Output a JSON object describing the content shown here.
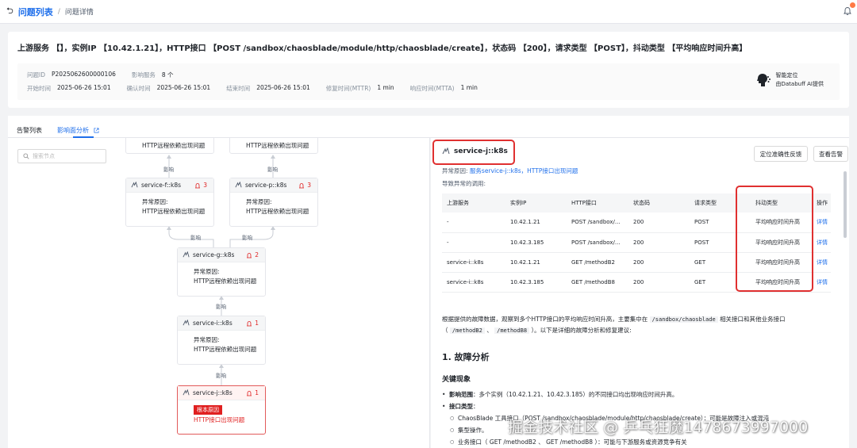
{
  "breadcrumb": {
    "back_glyph": "⮌",
    "list": "问题列表",
    "sep": "/",
    "current": "问题详情"
  },
  "summary": {
    "title": "上游服务 【】，实例IP 【10.42.1.21】，HTTP接口 【POST /sandbox/chaosblade/module/http/chaosblade/create】，状态码 【200】，请求类型 【POST】，抖动类型 【平均响应时间升高】",
    "row1": [
      {
        "k": "问题ID",
        "v": "P2025062600000106"
      },
      {
        "k": "影响服务",
        "v": "8 个"
      }
    ],
    "row2": [
      {
        "k": "开始时间",
        "v": "2025-06-26 15:01"
      },
      {
        "k": "确认时间",
        "v": "2025-06-26 15:01"
      },
      {
        "k": "结束时间",
        "v": "2025-06-26 15:01"
      },
      {
        "k": "修复时间(MTTR)",
        "v": "1 min"
      },
      {
        "k": "响应时间(MTTA)",
        "v": "1 min"
      }
    ],
    "ai": {
      "line1": "智能定位",
      "line2": "由Databuff AI提供"
    }
  },
  "tabs": {
    "alerts": "告警列表",
    "impact": "影响面分析"
  },
  "search": {
    "placeholder": "搜索节点"
  },
  "graph": {
    "edge_label": "影响",
    "cause_label": "异常原因:",
    "reason_http_dep": "HTTP远程依赖出现问题",
    "root_tag": "根本原因",
    "root_reason": "HTTP接口出现问题",
    "nodes": {
      "f": {
        "name": "service-f::k8s",
        "count": "3"
      },
      "p": {
        "name": "service-p::k8s",
        "count": "3"
      },
      "g": {
        "name": "service-g::k8s",
        "count": "2"
      },
      "i": {
        "name": "service-i::k8s",
        "count": "1"
      },
      "j": {
        "name": "service-j::k8s",
        "count": "1"
      }
    }
  },
  "detail": {
    "service": "service-j::k8s",
    "btn_feedback": "定位准确性反馈",
    "btn_alerts": "查看告警",
    "cause_label": "异常原因:",
    "cause_link": "服务service-j::k8s，HTTP接口出现问题",
    "calls_label": "导致异常的调用:",
    "table": {
      "headers": [
        "上游服务",
        "实例IP",
        "HTTP接口",
        "状态码",
        "请求类型",
        "抖动类型",
        "操作"
      ],
      "rows": [
        [
          "-",
          "10.42.1.21",
          "POST /sandbox/...",
          "200",
          "POST",
          "平均响应时间升高",
          "详情"
        ],
        [
          "-",
          "10.42.3.185",
          "POST /sandbox/...",
          "200",
          "POST",
          "平均响应时间升高",
          "详情"
        ],
        [
          "service-i::k8s",
          "10.42.1.21",
          "GET /methodB2",
          "200",
          "GET",
          "平均响应时间升高",
          "详情"
        ],
        [
          "service-i::k8s",
          "10.42.3.185",
          "GET /methodB8",
          "200",
          "GET",
          "平均响应时间升高",
          "详情"
        ]
      ]
    },
    "analysis": {
      "p1": "根据提供的故障数据，观察到多个HTTP接口的平均响应时间升高，主要集中在",
      "code1": "/sandbox/chaosblade",
      "p2": "相关接口和其他业务接口",
      "p3": "（",
      "code2": "/methodB2",
      "p4": "、",
      "code3": "/methodB8",
      "p5": "）。以下是详细的故障分析和修复建议:"
    },
    "h1": "1. 故障分析",
    "h2": "关键现象",
    "bullet1_label": "影响范围",
    "bullet1_text": "：多个实例（10.42.1.21、10.42.3.185）的不同接口均出现响应时间升高。",
    "bullet2_label": "接口类型",
    "bullet2_text": "：",
    "sub1": "ChaosBlade 工具接口（POST /sandbox/chaosblade/module/http/chaosblade/create）：可能是故障注入或混沌",
    "sub1b": "集型操作。",
    "sub2": "业务接口（ GET /methodB2 、 GET /methodB8 ）：可能与下游服务或资源竞争有关"
  },
  "watermark": "掘金技术社区 @ 乒乓狂魔1478673997000"
}
